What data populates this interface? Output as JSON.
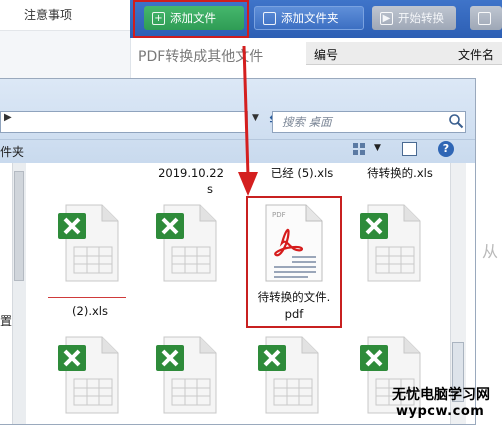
{
  "app": {
    "sidebar_tab": "注意事项",
    "toolbar": {
      "add_file": "添加文件",
      "add_folder": "添加文件夹",
      "start_convert": "开始转换"
    },
    "mode_label": "PDF转换成其他文件",
    "columns": {
      "number": "编号",
      "filename": "文件名"
    },
    "side_text": "从"
  },
  "dialog": {
    "search_placeholder": "搜索 桌面",
    "new_folder_label": "件夹",
    "nav_partial_label": "置",
    "files_top_partial": [
      "2019.10.22",
      "s",
      "已经 (5).xls",
      "待转换的.xls"
    ],
    "files": [
      {
        "name": "(2).xls",
        "type": "xls"
      },
      {
        "name": "",
        "type": "xls"
      },
      {
        "name": "待转换的文件.pdf",
        "name_line1": "待转换的文件.",
        "name_line2": "pdf",
        "type": "pdf",
        "selected": true
      },
      {
        "name": "",
        "type": "xls"
      },
      {
        "name": "",
        "type": "xls"
      },
      {
        "name": "",
        "type": "xls"
      },
      {
        "name": "",
        "type": "xls"
      },
      {
        "name": "",
        "type": "xls"
      }
    ],
    "pdf_badge": "PDF"
  },
  "watermark": {
    "title": "无忧电脑学习网",
    "url": "wypcw.com"
  },
  "colors": {
    "highlight": "#cf1d1d",
    "excel_green": "#2e8b3a",
    "toolbar_blue": "#2d5fb4",
    "add_green": "#35a65e"
  }
}
